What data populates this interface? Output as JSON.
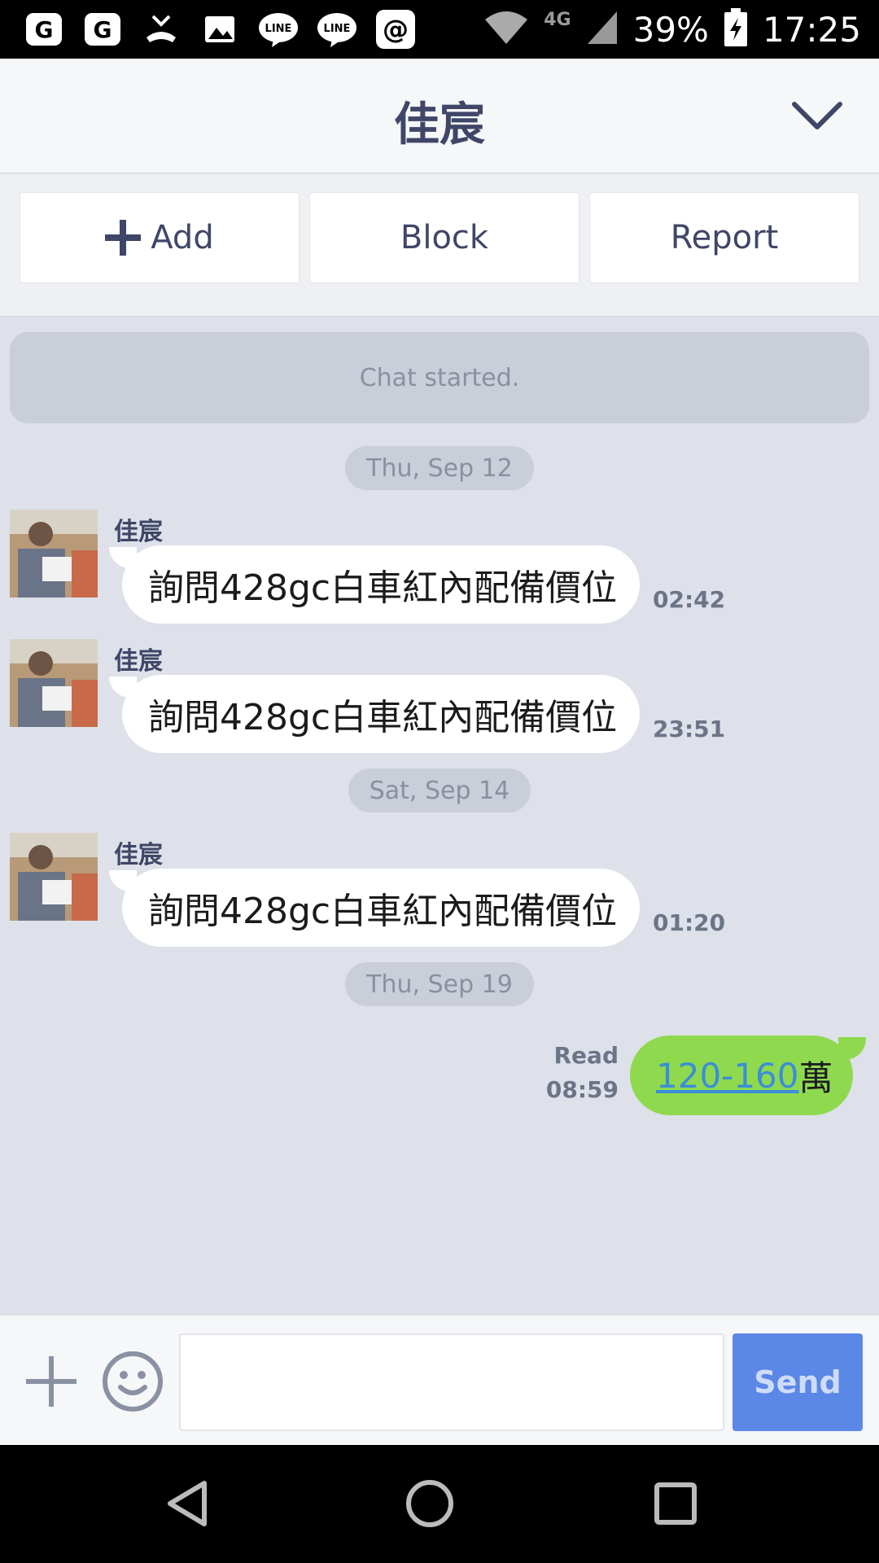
{
  "status_bar": {
    "icons": [
      "google-icon",
      "google-icon",
      "missed-call-icon",
      "image-icon",
      "line-icon",
      "line-icon",
      "at-sign-icon"
    ],
    "network": "4G",
    "battery": "39%",
    "time": "17:25"
  },
  "header": {
    "title": "佳宸"
  },
  "actions": {
    "add": "Add",
    "block": "Block",
    "report": "Report"
  },
  "chat": {
    "system_message": "Chat started.",
    "dates": [
      "Thu, Sep 12",
      "Sat, Sep 14",
      "Thu, Sep 19"
    ],
    "incoming": [
      {
        "sender": "佳宸",
        "text": "詢問428gc白車紅內配備價位",
        "time": "02:42"
      },
      {
        "sender": "佳宸",
        "text": "詢問428gc白車紅內配備價位",
        "time": "23:51"
      },
      {
        "sender": "佳宸",
        "text": "詢問428gc白車紅內配備價位",
        "time": "01:20"
      }
    ],
    "outgoing": {
      "link_text": "120-160",
      "suffix": "萬",
      "read_label": "Read",
      "time": "08:59"
    }
  },
  "input": {
    "placeholder": "",
    "send_label": "Send"
  },
  "colors": {
    "accent": "#5b87e6",
    "outgoing_bubble": "#8fd94f",
    "title_text": "#3f4667"
  }
}
